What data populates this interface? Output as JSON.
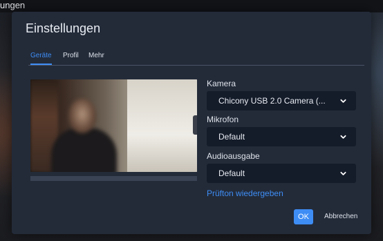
{
  "background": {
    "top_text": "ungen"
  },
  "dialog": {
    "title": "Einstellungen",
    "tabs": [
      {
        "label": "Geräte",
        "active": true
      },
      {
        "label": "Profil",
        "active": false
      },
      {
        "label": "Mehr",
        "active": false
      }
    ],
    "audio_level": 0.0,
    "camera": {
      "label": "Kamera",
      "value": "Chicony USB 2.0 Camera (..."
    },
    "microphone": {
      "label": "Mikrofon",
      "value": "Default"
    },
    "audio_output": {
      "label": "Audioausgabe",
      "value": "Default"
    },
    "test_sound_link": "Prüfton wiedergeben",
    "ok_label": "OK",
    "cancel_label": "Abbrechen"
  },
  "icons": {
    "dropdown": "chevron-down-icon"
  },
  "colors": {
    "accent": "#3e8df5",
    "dialog_bg": "#232b39",
    "select_bg": "#141b29"
  }
}
